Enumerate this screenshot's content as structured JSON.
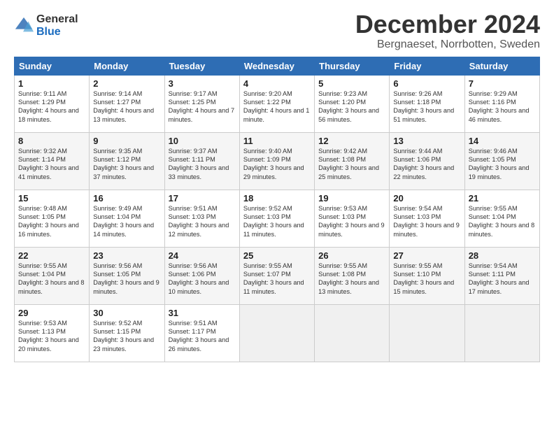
{
  "logo": {
    "general": "General",
    "blue": "Blue"
  },
  "title": "December 2024",
  "subtitle": "Bergnaeset, Norrbotten, Sweden",
  "weekdays": [
    "Sunday",
    "Monday",
    "Tuesday",
    "Wednesday",
    "Thursday",
    "Friday",
    "Saturday"
  ],
  "weeks": [
    [
      {
        "day": "1",
        "sunrise": "Sunrise: 9:11 AM",
        "sunset": "Sunset: 1:29 PM",
        "daylight": "Daylight: 4 hours and 18 minutes."
      },
      {
        "day": "2",
        "sunrise": "Sunrise: 9:14 AM",
        "sunset": "Sunset: 1:27 PM",
        "daylight": "Daylight: 4 hours and 13 minutes."
      },
      {
        "day": "3",
        "sunrise": "Sunrise: 9:17 AM",
        "sunset": "Sunset: 1:25 PM",
        "daylight": "Daylight: 4 hours and 7 minutes."
      },
      {
        "day": "4",
        "sunrise": "Sunrise: 9:20 AM",
        "sunset": "Sunset: 1:22 PM",
        "daylight": "Daylight: 4 hours and 1 minute."
      },
      {
        "day": "5",
        "sunrise": "Sunrise: 9:23 AM",
        "sunset": "Sunset: 1:20 PM",
        "daylight": "Daylight: 3 hours and 56 minutes."
      },
      {
        "day": "6",
        "sunrise": "Sunrise: 9:26 AM",
        "sunset": "Sunset: 1:18 PM",
        "daylight": "Daylight: 3 hours and 51 minutes."
      },
      {
        "day": "7",
        "sunrise": "Sunrise: 9:29 AM",
        "sunset": "Sunset: 1:16 PM",
        "daylight": "Daylight: 3 hours and 46 minutes."
      }
    ],
    [
      {
        "day": "8",
        "sunrise": "Sunrise: 9:32 AM",
        "sunset": "Sunset: 1:14 PM",
        "daylight": "Daylight: 3 hours and 41 minutes."
      },
      {
        "day": "9",
        "sunrise": "Sunrise: 9:35 AM",
        "sunset": "Sunset: 1:12 PM",
        "daylight": "Daylight: 3 hours and 37 minutes."
      },
      {
        "day": "10",
        "sunrise": "Sunrise: 9:37 AM",
        "sunset": "Sunset: 1:11 PM",
        "daylight": "Daylight: 3 hours and 33 minutes."
      },
      {
        "day": "11",
        "sunrise": "Sunrise: 9:40 AM",
        "sunset": "Sunset: 1:09 PM",
        "daylight": "Daylight: 3 hours and 29 minutes."
      },
      {
        "day": "12",
        "sunrise": "Sunrise: 9:42 AM",
        "sunset": "Sunset: 1:08 PM",
        "daylight": "Daylight: 3 hours and 25 minutes."
      },
      {
        "day": "13",
        "sunrise": "Sunrise: 9:44 AM",
        "sunset": "Sunset: 1:06 PM",
        "daylight": "Daylight: 3 hours and 22 minutes."
      },
      {
        "day": "14",
        "sunrise": "Sunrise: 9:46 AM",
        "sunset": "Sunset: 1:05 PM",
        "daylight": "Daylight: 3 hours and 19 minutes."
      }
    ],
    [
      {
        "day": "15",
        "sunrise": "Sunrise: 9:48 AM",
        "sunset": "Sunset: 1:05 PM",
        "daylight": "Daylight: 3 hours and 16 minutes."
      },
      {
        "day": "16",
        "sunrise": "Sunrise: 9:49 AM",
        "sunset": "Sunset: 1:04 PM",
        "daylight": "Daylight: 3 hours and 14 minutes."
      },
      {
        "day": "17",
        "sunrise": "Sunrise: 9:51 AM",
        "sunset": "Sunset: 1:03 PM",
        "daylight": "Daylight: 3 hours and 12 minutes."
      },
      {
        "day": "18",
        "sunrise": "Sunrise: 9:52 AM",
        "sunset": "Sunset: 1:03 PM",
        "daylight": "Daylight: 3 hours and 11 minutes."
      },
      {
        "day": "19",
        "sunrise": "Sunrise: 9:53 AM",
        "sunset": "Sunset: 1:03 PM",
        "daylight": "Daylight: 3 hours and 9 minutes."
      },
      {
        "day": "20",
        "sunrise": "Sunrise: 9:54 AM",
        "sunset": "Sunset: 1:03 PM",
        "daylight": "Daylight: 3 hours and 9 minutes."
      },
      {
        "day": "21",
        "sunrise": "Sunrise: 9:55 AM",
        "sunset": "Sunset: 1:04 PM",
        "daylight": "Daylight: 3 hours and 8 minutes."
      }
    ],
    [
      {
        "day": "22",
        "sunrise": "Sunrise: 9:55 AM",
        "sunset": "Sunset: 1:04 PM",
        "daylight": "Daylight: 3 hours and 8 minutes."
      },
      {
        "day": "23",
        "sunrise": "Sunrise: 9:56 AM",
        "sunset": "Sunset: 1:05 PM",
        "daylight": "Daylight: 3 hours and 9 minutes."
      },
      {
        "day": "24",
        "sunrise": "Sunrise: 9:56 AM",
        "sunset": "Sunset: 1:06 PM",
        "daylight": "Daylight: 3 hours and 10 minutes."
      },
      {
        "day": "25",
        "sunrise": "Sunrise: 9:55 AM",
        "sunset": "Sunset: 1:07 PM",
        "daylight": "Daylight: 3 hours and 11 minutes."
      },
      {
        "day": "26",
        "sunrise": "Sunrise: 9:55 AM",
        "sunset": "Sunset: 1:08 PM",
        "daylight": "Daylight: 3 hours and 13 minutes."
      },
      {
        "day": "27",
        "sunrise": "Sunrise: 9:55 AM",
        "sunset": "Sunset: 1:10 PM",
        "daylight": "Daylight: 3 hours and 15 minutes."
      },
      {
        "day": "28",
        "sunrise": "Sunrise: 9:54 AM",
        "sunset": "Sunset: 1:11 PM",
        "daylight": "Daylight: 3 hours and 17 minutes."
      }
    ],
    [
      {
        "day": "29",
        "sunrise": "Sunrise: 9:53 AM",
        "sunset": "Sunset: 1:13 PM",
        "daylight": "Daylight: 3 hours and 20 minutes."
      },
      {
        "day": "30",
        "sunrise": "Sunrise: 9:52 AM",
        "sunset": "Sunset: 1:15 PM",
        "daylight": "Daylight: 3 hours and 23 minutes."
      },
      {
        "day": "31",
        "sunrise": "Sunrise: 9:51 AM",
        "sunset": "Sunset: 1:17 PM",
        "daylight": "Daylight: 3 hours and 26 minutes."
      },
      null,
      null,
      null,
      null
    ]
  ]
}
